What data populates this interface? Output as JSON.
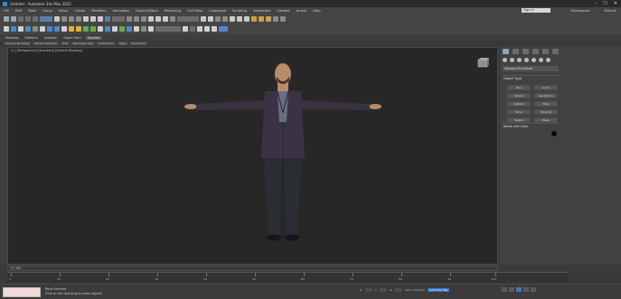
{
  "window": {
    "title": "Untitled - Autodesk 3ds Max 2022",
    "controls": [
      "–",
      "☐",
      "✕"
    ]
  },
  "menubar": {
    "items": [
      "File",
      "Edit",
      "Tools",
      "Group",
      "Views",
      "Create",
      "Modifiers",
      "Animation",
      "Graph Editors",
      "Rendering",
      "Civil View",
      "Customize",
      "Scripting",
      "Interactive",
      "Content",
      "Arnold",
      "Help"
    ],
    "sign_in": "Sign In",
    "workspace_label": "Workspaces:",
    "workspace_value": "Default"
  },
  "ribbon": {
    "tabs": [
      "Modeling",
      "Freeform",
      "Selection",
      "Object Paint",
      "Populate"
    ],
    "active": "Populate",
    "sub_items": [
      "Polygon Modeling",
      "Modify Selection",
      "Edit",
      "Geometry (All)",
      "Subdivision",
      "Align",
      "Properties"
    ]
  },
  "viewport": {
    "label": "[+] [Perspective] [Standard] [Default Shading]"
  },
  "command_panel": {
    "dropdown": "Standard Primitives",
    "object_type_title": "Object Type",
    "buttons": [
      "Box",
      "Cone",
      "Sphere",
      "GeoSphere",
      "Cylinder",
      "Tube",
      "Torus",
      "Pyramid",
      "Teapot",
      "Plane"
    ],
    "name_color_title": "Name and Color"
  },
  "timeline": {
    "slider_label": "0 / 100",
    "ticks": [
      "0",
      "10",
      "20",
      "30",
      "40",
      "50",
      "60",
      "70",
      "80",
      "90",
      "100"
    ]
  },
  "status": {
    "line1": "None Selected",
    "line2": "Click or click-and-drag to select objects",
    "coords": [
      "X:",
      "Y:",
      "Z:",
      "Grid = 10.0cm"
    ],
    "add_time_tag": "Add Time Tag",
    "auto_key": "Auto Key",
    "set_key": "Set Key",
    "selected": "Selected",
    "key_filters": "Key Filters..."
  },
  "colors": {
    "viewport_bg": "#272727",
    "accent_blue": "#3c78c8",
    "ui_bg": "#3a3a3a",
    "listener_pink": "#f0d9dd"
  }
}
